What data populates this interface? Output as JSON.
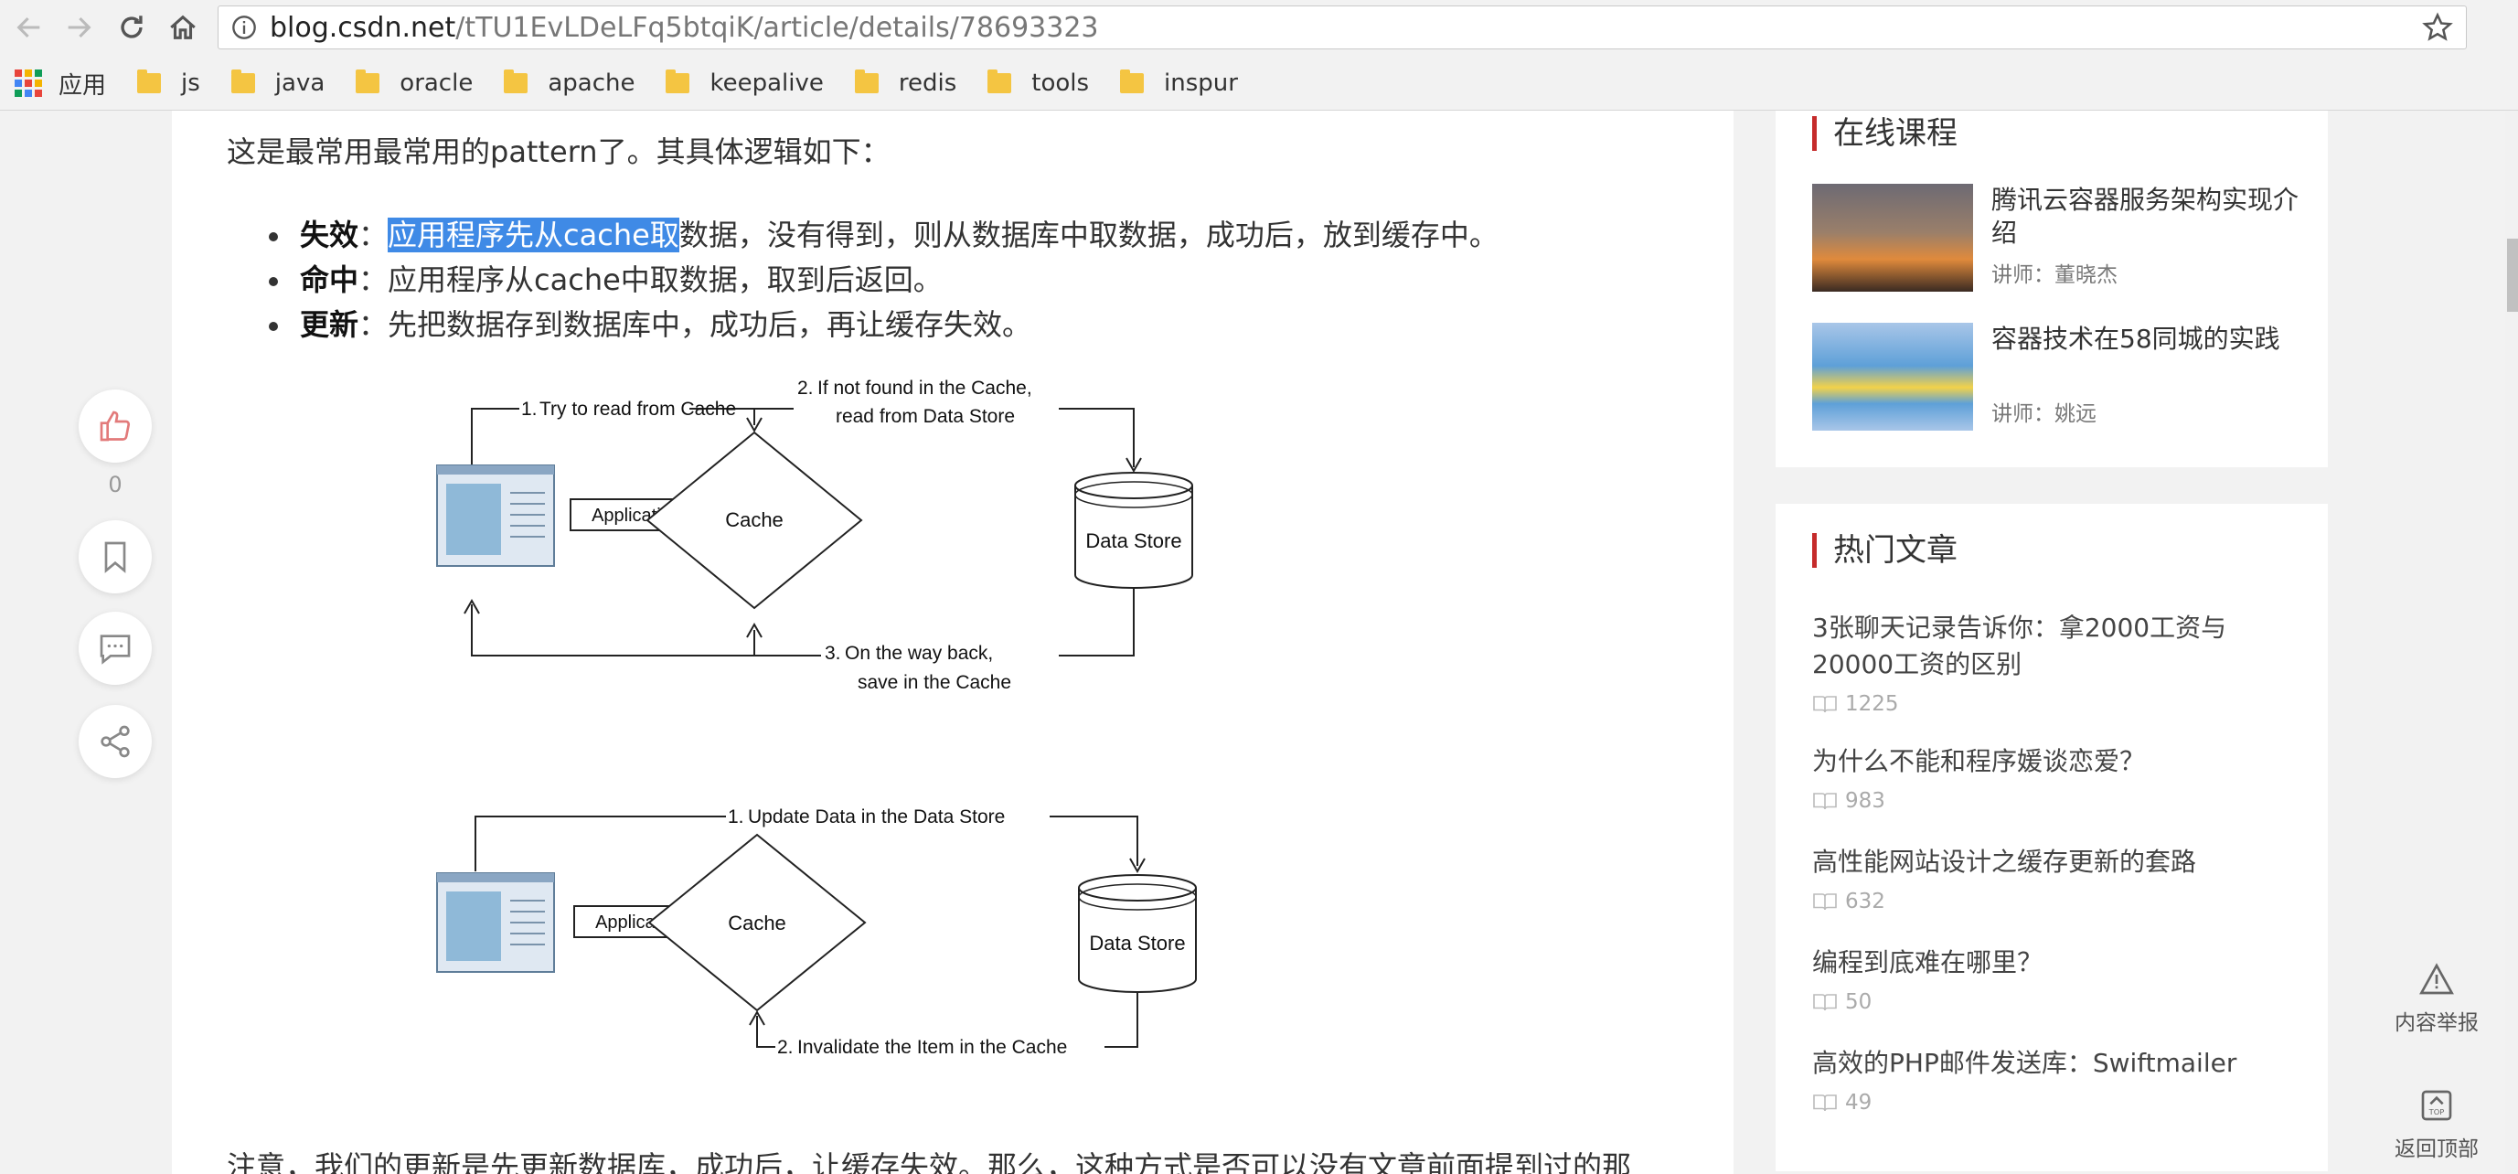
{
  "browser": {
    "url_domain": "blog.csdn.net",
    "url_path": "/tTU1EvLDeLFq5btqiK/article/details/78693323",
    "bookmarks": [
      "应用",
      "js",
      "java",
      "oracle",
      "apache",
      "keepalive",
      "redis",
      "tools",
      "inspur"
    ]
  },
  "article": {
    "intro": "这是最常用最常用的pattern了。其具体逻辑如下：",
    "bullets": [
      {
        "term": "失效",
        "sep": "：",
        "selected": "应用程序先从cache取",
        "rest": "数据，没有得到，则从数据库中取数据，成功后，放到缓存中。"
      },
      {
        "term": "命中",
        "sep": "：",
        "selected": "",
        "rest": "应用程序从cache中取数据，取到后返回。"
      },
      {
        "term": "更新",
        "sep": "：",
        "selected": "",
        "rest": "先把数据存到数据库中，成功后，再让缓存失效。"
      }
    ],
    "diagram1": {
      "step1_num": "1.",
      "step1_text": "Try to read from Cache",
      "step2_num": "2.",
      "step2_line1": "If not found in the Cache,",
      "step2_line2": "read from Data Store",
      "step3_num": "3.",
      "step3_line1": "On the way back,",
      "step3_line2": "save in the Cache",
      "app_label": "Application",
      "cache_label": "Cache",
      "store_label": "Data Store"
    },
    "diagram2": {
      "step1_num": "1.",
      "step1_text": "Update Data in the Data Store",
      "step2_num": "2.",
      "step2_text": "Invalidate the Item in the Cache",
      "app_label": "Application",
      "cache_label": "Cache",
      "store_label": "Data Store"
    },
    "bottom_text": "注意，我们的更新是先更新数据库，成功后，让缓存失效。那么，这种方式是否可以没有文章前面提到过的那"
  },
  "left_actions": {
    "like_count": "0"
  },
  "sidebar": {
    "courses_title": "在线课程",
    "courses": [
      {
        "title": "腾讯云容器服务架构实现介绍",
        "teacher": "讲师：董晓杰"
      },
      {
        "title": "容器技术在58同城的实践",
        "teacher": "讲师：姚远"
      }
    ],
    "hot_title": "热门文章",
    "hot": [
      {
        "title": "3张聊天记录告诉你：拿2000工资与20000工资的区别",
        "views": "1225"
      },
      {
        "title": "为什么不能和程序媛谈恋爱？",
        "views": "983"
      },
      {
        "title": "高性能网站设计之缓存更新的套路",
        "views": "632"
      },
      {
        "title": "编程到底难在哪里？",
        "views": "50"
      },
      {
        "title": "高效的PHP邮件发送库：Swiftmailer",
        "views": "49"
      }
    ]
  },
  "right_tools": {
    "report": "内容举报",
    "top": "返回顶部"
  },
  "colors": {
    "accent_red": "#c52b2b",
    "selection_blue": "#3f8ae6"
  }
}
